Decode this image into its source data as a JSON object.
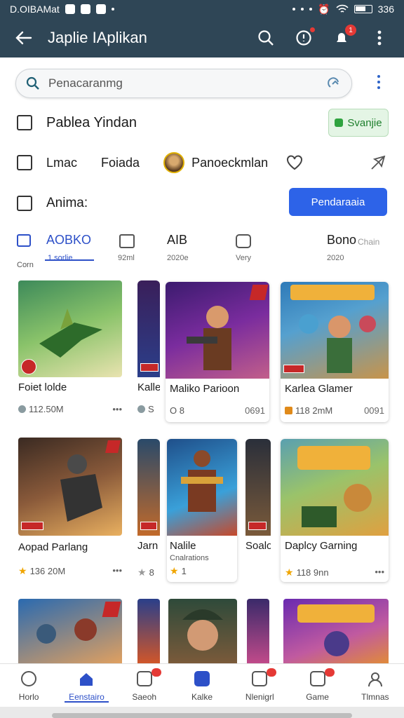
{
  "status_bar": {
    "left_text": "D.OIBAMat",
    "right_text": "336"
  },
  "app_bar": {
    "title": "Japlie IAplikan",
    "notification_badge": "1"
  },
  "search": {
    "placeholder": "Penacaranmg"
  },
  "section_title": {
    "label": "Pablea Yindan",
    "button": "Svanjie"
  },
  "filters": {
    "item1": "Lmac",
    "item2": "Foiada",
    "item3": "Panoeckmlan"
  },
  "anime_row": {
    "label": "Anima:",
    "button": "Pendaraaia"
  },
  "tabs": [
    {
      "label": "AOBKO",
      "sub": "1 sorlie"
    },
    {
      "label": "",
      "sub": "92ml"
    },
    {
      "label": "AIB",
      "sub": "2020e"
    },
    {
      "label": "",
      "sub": "Very"
    },
    {
      "label": "Bono",
      "sub": "2020"
    }
  ],
  "tabs_extra": {
    "corner": "Corn",
    "chain": "Chain"
  },
  "games": [
    {
      "name": "Foiet lolde",
      "meta": "112.50M",
      "more": "•••"
    },
    {
      "name": "Kalle",
      "meta": "S",
      "more": ""
    },
    {
      "name": "Maliko Parioon",
      "meta": "O 8",
      "more": "0691"
    },
    {
      "name": "Karlea Glamer",
      "meta": "118 2mM",
      "more": "0091"
    },
    {
      "name": "Aopad Parlang",
      "meta": "136 20M",
      "more": "•••"
    },
    {
      "name": "Jarn",
      "meta": "8",
      "more": ""
    },
    {
      "name": "Nalile",
      "sub": "Cnalrations",
      "meta": "1",
      "more": ""
    },
    {
      "name": "Soalo",
      "meta": "",
      "more": ""
    },
    {
      "name": "Daplcy Garning",
      "meta": "118 9nn",
      "more": "•••"
    }
  ],
  "bottom_nav": [
    {
      "label": "Horlo"
    },
    {
      "label": "Eenstairo"
    },
    {
      "label": "Saeoh"
    },
    {
      "label": "Kalke"
    },
    {
      "label": "Nlenigrl"
    },
    {
      "label": "Game"
    },
    {
      "label": "Tlmnas"
    }
  ]
}
